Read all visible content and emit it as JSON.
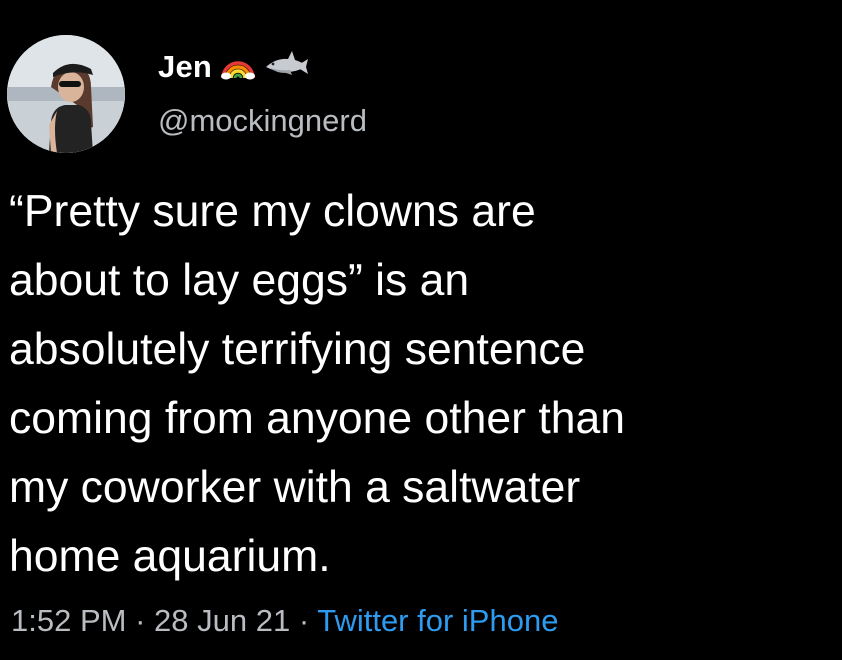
{
  "tweet": {
    "display_name": "Jen",
    "handle": "@mockingnerd",
    "badges": [
      "rainbow-icon",
      "shark-icon"
    ],
    "text_lines": [
      "“Pretty sure my clowns are",
      "about to lay eggs” is an",
      "absolutely terrifying sentence",
      "coming from anyone other than",
      "my coworker with a saltwater",
      "home aquarium."
    ],
    "time": "1:52 PM",
    "date": "28 Jun 21",
    "source": "Twitter for iPhone",
    "separator": "·"
  },
  "colors": {
    "background": "#000000",
    "text": "#ffffff",
    "secondary_text": "#b9bcc0",
    "link": "#2d9bf0"
  }
}
